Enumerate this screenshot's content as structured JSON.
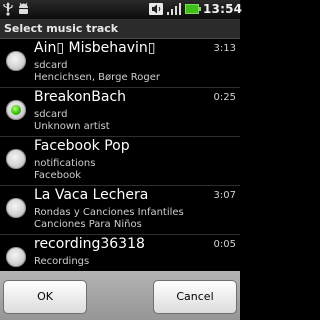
{
  "status_bar": {
    "time": "13:54",
    "icons": [
      "usb-icon",
      "android-debug-icon",
      "volume-icon",
      "signal-icon",
      "battery-icon"
    ]
  },
  "dialog": {
    "title": "Select music track"
  },
  "tracks": [
    {
      "title": "Ain▯ Misbehavin▯",
      "line1": "sdcard",
      "line2": "Hencichsen, Børge Roger",
      "duration": "3:13",
      "selected": false
    },
    {
      "title": "BreakonBach",
      "line1": "sdcard",
      "line2": "Unknown artist",
      "duration": "0:25",
      "selected": true
    },
    {
      "title": "Facebook Pop",
      "line1": "notifications",
      "line2": "Facebook",
      "duration": "",
      "selected": false
    },
    {
      "title": "La Vaca Lechera",
      "line1": "Rondas y Canciones Infantiles",
      "line2": "Canciones Para Niños",
      "duration": "3:07",
      "selected": false
    },
    {
      "title": "recording36318",
      "line1": "Recordings",
      "line2": "",
      "duration": "0:05",
      "selected": false
    }
  ],
  "buttons": {
    "ok": "OK",
    "cancel": "Cancel"
  },
  "colors": {
    "background": "#000000",
    "selected_radio": "#39c20c",
    "button_bar": "#9c9c9c"
  }
}
